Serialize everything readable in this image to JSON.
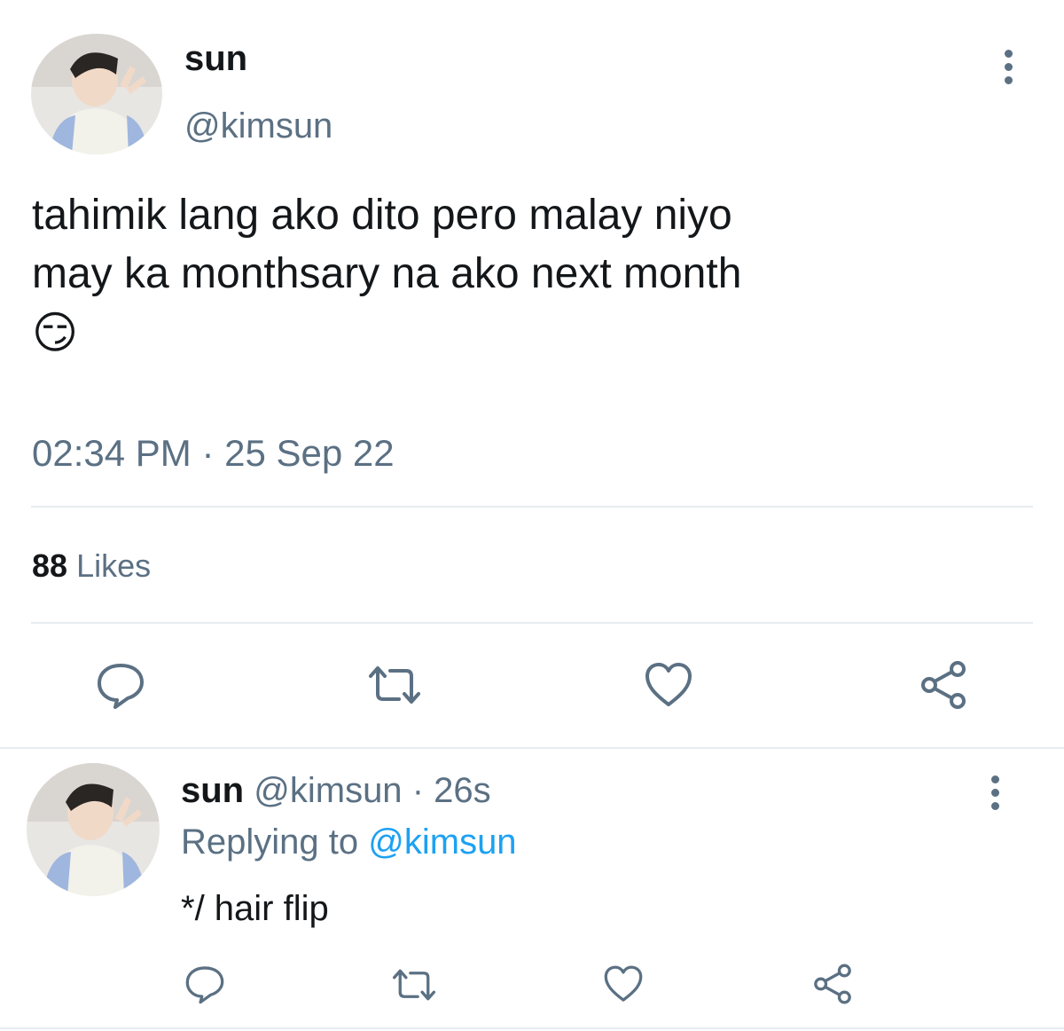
{
  "main_tweet": {
    "display_name": "sun",
    "handle": "@kimsun",
    "text_line1": "tahimik lang ako dito pero malay niyo",
    "text_line2": "may ka monthsary na ako next month",
    "emoji": "😏",
    "timestamp": "02:34 PM · 25 Sep 22",
    "likes_count": "88",
    "likes_label": "Likes"
  },
  "reply_tweet": {
    "display_name": "sun",
    "handle": "@kimsun",
    "age": "· 26s",
    "replying_prefix": "Replying to",
    "replying_handle": "@kimsun",
    "text": "*/ hair flip"
  },
  "icons": {
    "more": "more-vertical-icon",
    "reply": "comment-bubble-icon",
    "retweet": "retweet-icon",
    "like": "heart-icon",
    "share": "share-icon"
  },
  "colors": {
    "text": "#14171a",
    "secondary": "#5b7083",
    "link": "#1da1f2",
    "divider": "#e6ecf0"
  }
}
